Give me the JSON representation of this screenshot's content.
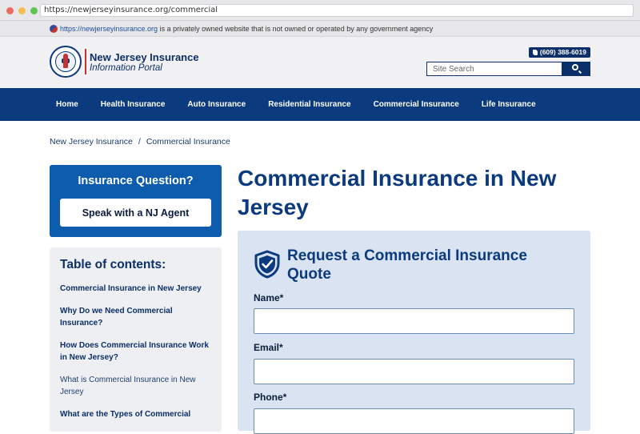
{
  "browser": {
    "url": "https://newjerseyinsurance.org/commercial"
  },
  "notice": {
    "link": "https://newjerseyinsurance.org",
    "text": " is a privately owned website that is not owned or operated by any government agency"
  },
  "header": {
    "brand_title": "New Jersey Insurance",
    "brand_subtitle": "Information Portal",
    "phone": "(609) 388-6019",
    "search_placeholder": "Site Search"
  },
  "nav": {
    "items": [
      {
        "label": "Home"
      },
      {
        "label": "Health Insurance"
      },
      {
        "label": "Auto Insurance"
      },
      {
        "label": "Residential Insurance"
      },
      {
        "label": "Commercial Insurance"
      },
      {
        "label": "Life Insurance"
      }
    ]
  },
  "breadcrumb": {
    "home": "New Jersey Insurance",
    "separator": "/",
    "current": "Commercial Insurance"
  },
  "sidebar": {
    "question_title": "Insurance Question?",
    "agent_button": "Speak with a NJ Agent",
    "toc_title": "Table of contents:",
    "toc_items": [
      {
        "label": "Commercial Insurance in New Jersey"
      },
      {
        "label": "Why Do we Need Commercial Insurance?"
      },
      {
        "label": "How Does Commercial Insurance Work in New Jersey?"
      },
      {
        "label": "What is Commercial Insurance in New Jersey"
      },
      {
        "label": "What are the Types of Commercial"
      }
    ]
  },
  "main": {
    "title": "Commercial Insurance in New Jersey",
    "form_title": "Request a Commercial Insurance Quote",
    "fields": {
      "name_label": "Name*",
      "email_label": "Email*",
      "phone_label": "Phone*"
    }
  },
  "colors": {
    "nav_blue": "#0b3a7e",
    "sidebar_blue": "#0d5cae",
    "form_bg": "#d9e3f2",
    "accent_red": "#c6322f"
  }
}
